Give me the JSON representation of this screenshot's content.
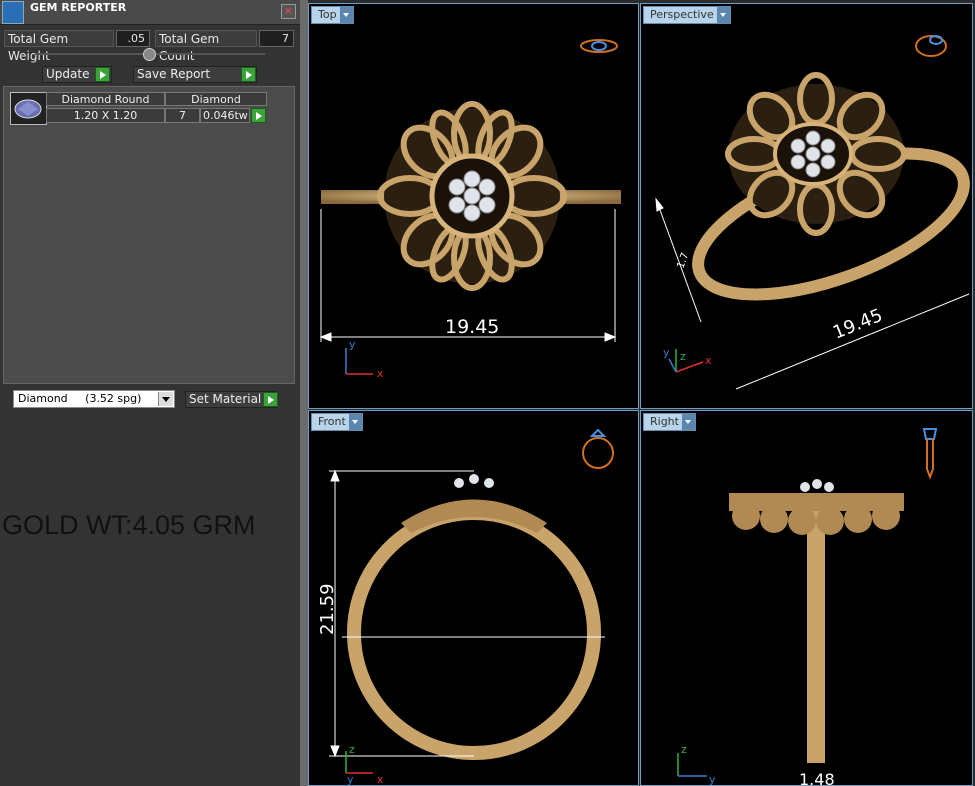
{
  "panel": {
    "title": "GEM REPORTER",
    "close_glyph": "×",
    "total_gem_weight_label": "Total Gem Weight",
    "total_gem_weight_value": ".05",
    "total_gem_count_label": "Total Gem Count",
    "total_gem_count_value": "7",
    "update_label": "Update",
    "save_report_label": "Save Report",
    "table": {
      "headers": [
        "Diamond Round",
        "Diamond"
      ],
      "row": {
        "size": "1.20 X 1.20",
        "count": "7",
        "weight": "0.046tw"
      }
    },
    "material": "Diamond     (3.52 spg)",
    "set_material_label": "Set Material",
    "note": "GOLD WT:4.05 GRM"
  },
  "viewports": {
    "top": {
      "label": "Top",
      "dimension": "19.45",
      "axes": [
        "y",
        "x"
      ]
    },
    "perspective": {
      "label": "Perspective",
      "dimension": "19.45",
      "dimension_small": "1.7",
      "axes": [
        "z",
        "y",
        "x"
      ]
    },
    "front": {
      "label": "Front",
      "dimension": "21.59",
      "axes": [
        "z",
        "y",
        "x"
      ]
    },
    "right": {
      "label": "Right",
      "dimension": "1.48",
      "axes": [
        "z",
        "y"
      ]
    }
  },
  "colors": {
    "gold": "#c9a46a",
    "gold_dark": "#8a6a3c",
    "axis_x": "#e03030",
    "axis_y": "#3a7ad0",
    "axis_z": "#30b040",
    "viewport_border": "#6aa0c8"
  }
}
